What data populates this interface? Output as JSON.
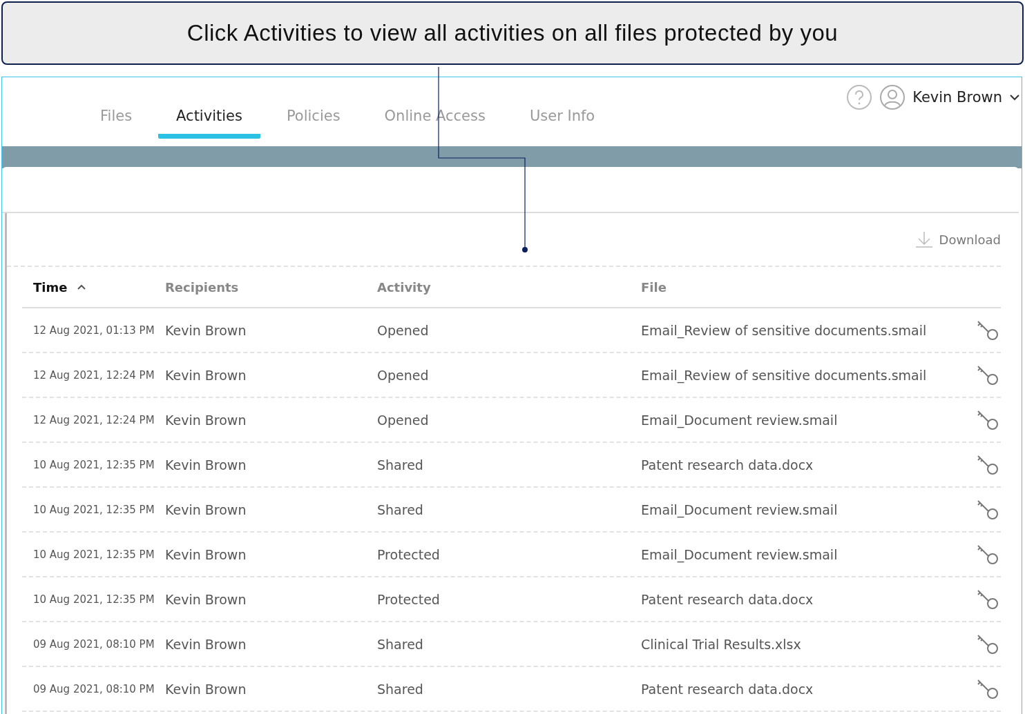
{
  "callout": {
    "text": "Click Activities to view all activities on all files protected by you"
  },
  "tabs": [
    {
      "label": "Files",
      "selected": false
    },
    {
      "label": "Activities",
      "selected": true
    },
    {
      "label": "Policies",
      "selected": false
    },
    {
      "label": "Online Access",
      "selected": false
    },
    {
      "label": "User Info",
      "selected": false
    }
  ],
  "user": {
    "name": "Kevin Brown"
  },
  "toolbar": {
    "download": "Download"
  },
  "table": {
    "columns": [
      {
        "label": "Time",
        "sorted": true
      },
      {
        "label": "Recipients",
        "sorted": false
      },
      {
        "label": "Activity",
        "sorted": false
      },
      {
        "label": "File",
        "sorted": false
      }
    ],
    "rows": [
      [
        "12 Aug 2021, 01:13 PM",
        "Kevin Brown",
        "Opened",
        "Email_Review of sensitive documents.smail"
      ],
      [
        "12 Aug 2021, 12:24 PM",
        "Kevin Brown",
        "Opened",
        "Email_Review of sensitive documents.smail"
      ],
      [
        "12 Aug 2021, 12:24 PM",
        "Kevin Brown",
        "Opened",
        "Email_Document review.smail"
      ],
      [
        "10 Aug 2021, 12:35 PM",
        "Kevin Brown",
        "Shared",
        "Patent research data.docx"
      ],
      [
        "10 Aug 2021, 12:35 PM",
        "Kevin Brown",
        "Shared",
        "Email_Document review.smail"
      ],
      [
        "10 Aug 2021, 12:35 PM",
        "Kevin Brown",
        "Protected",
        "Email_Document review.smail"
      ],
      [
        "10 Aug 2021, 12:35 PM",
        "Kevin Brown",
        "Protected",
        "Patent research data.docx"
      ],
      [
        "09 Aug 2021, 08:10 PM",
        "Kevin Brown",
        "Shared",
        "Clinical Trial Results.xlsx"
      ],
      [
        "09 Aug 2021, 08:10 PM",
        "Kevin Brown",
        "Shared",
        "Patent research data.docx"
      ]
    ]
  }
}
